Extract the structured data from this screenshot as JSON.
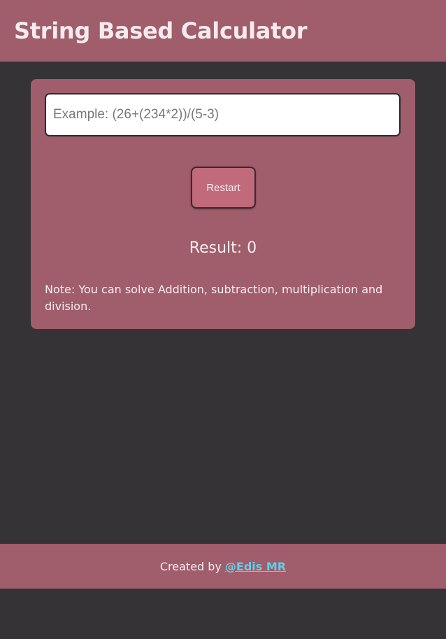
{
  "header": {
    "title": "String Based Calculator"
  },
  "calculator": {
    "input_placeholder": "Example: (26+(234*2))/(5-3)",
    "input_value": "",
    "restart_label": "Restart",
    "result_text": "Result: 0",
    "note": "Note: You can solve Addition, subtraction, multiplication and division."
  },
  "footer": {
    "created_by": "Created by",
    "author_link": "@Edis MR"
  },
  "colors": {
    "background": "#353335",
    "panel": "#a05d6c",
    "button": "#c06a7b",
    "link": "#5cd2ea"
  }
}
